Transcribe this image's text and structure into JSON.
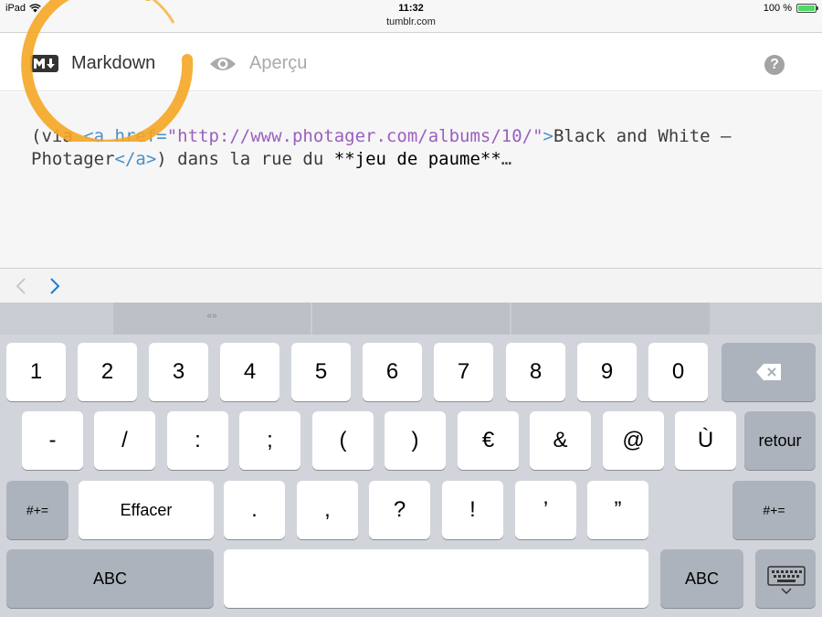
{
  "status": {
    "device": "iPad",
    "time": "11:32",
    "url": "tumblr.com",
    "battery": "100 %",
    "battery_level": 1.0
  },
  "editor": {
    "markdown_tab": "Markdown",
    "preview_tab": "Aperçu",
    "help_symbol": "?",
    "code": {
      "t1": "(via ",
      "t2": "<a href=",
      "t3": "\"http://www.photager.com/albums/10/\"",
      "t4": ">",
      "t5": "Black and White – Photager",
      "t6": "</a>",
      "t7": ") dans la rue du ",
      "t8": "**jeu de paume**",
      "t9": "…"
    }
  },
  "toolbar": {
    "prev_icon": "chevron-left-icon",
    "next_icon": "chevron-right-icon"
  },
  "keyboard": {
    "suggestions": [
      "",
      "«»",
      "",
      "",
      ""
    ],
    "row1": [
      "1",
      "2",
      "3",
      "4",
      "5",
      "6",
      "7",
      "8",
      "9",
      "0"
    ],
    "row2": [
      "-",
      "/",
      ":",
      ";",
      "(",
      ")",
      "€",
      "&",
      "@",
      "Ù"
    ],
    "row3": [
      ".",
      ",",
      "?",
      "!",
      "’",
      "”"
    ],
    "return_label": "retour",
    "symbols_label": "#+=",
    "undo_label": "Effacer",
    "abc_label": "ABC",
    "space_label": ""
  },
  "colors": {
    "highlight_ring": "#f5a623",
    "tag": "#4a90c9",
    "string": "#9b5fc0",
    "next_arrow": "#1a7ed8"
  }
}
